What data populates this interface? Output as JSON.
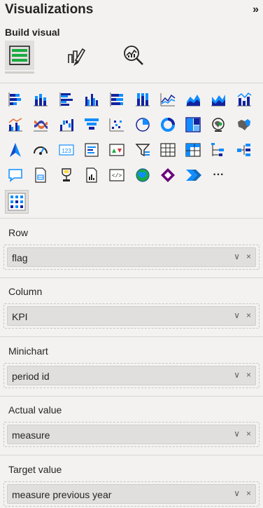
{
  "panel": {
    "title": "Visualizations",
    "collapse_glyph": "»",
    "subtitle": "Build visual"
  },
  "modes": [
    {
      "icon": "build-visual-icon",
      "active": true
    },
    {
      "icon": "format-visual-icon",
      "active": false
    },
    {
      "icon": "analytics-icon",
      "active": false
    }
  ],
  "visuals": [
    "stacked-bar-icon",
    "stacked-column-icon",
    "clustered-bar-icon",
    "clustered-column-icon",
    "100-stacked-bar-icon",
    "100-stacked-column-icon",
    "line-chart-icon",
    "area-chart-icon",
    "stacked-area-icon",
    "line-column-icon",
    "line-clustered-column-icon",
    "ribbon-chart-icon",
    "waterfall-icon",
    "funnel-icon",
    "scatter-icon",
    "pie-chart-icon",
    "donut-chart-icon",
    "treemap-icon",
    "map-icon",
    "filled-map-icon",
    "azure-map-icon",
    "gauge-icon",
    "card-icon",
    "multi-row-card-icon",
    "kpi-icon",
    "slicer-icon",
    "table-icon",
    "matrix-icon",
    "decomposition-tree-icon",
    "key-influencers-icon",
    "qna-icon",
    "paginated-report-icon",
    "smart-narrative-icon",
    "r-visual-icon",
    "python-visual-icon",
    "arcgis-map-icon",
    "power-apps-icon",
    "power-automate-icon",
    "more-visuals-icon"
  ],
  "more_glyph": "···",
  "selected_visual_icon": "custom-visual-icon",
  "wells": [
    {
      "label": "Row",
      "field": "flag"
    },
    {
      "label": "Column",
      "field": "KPI"
    },
    {
      "label": "Minichart",
      "field": "period id"
    },
    {
      "label": "Actual value",
      "field": "measure"
    },
    {
      "label": "Target value",
      "field": "measure previous year"
    }
  ],
  "glyphs": {
    "chevron": "∨",
    "remove": "×"
  },
  "colors": {
    "accent": "#118dff",
    "dark_blue": "#12239e",
    "orange": "#e66c37",
    "purple": "#6b007b",
    "green": "#1aab40"
  }
}
